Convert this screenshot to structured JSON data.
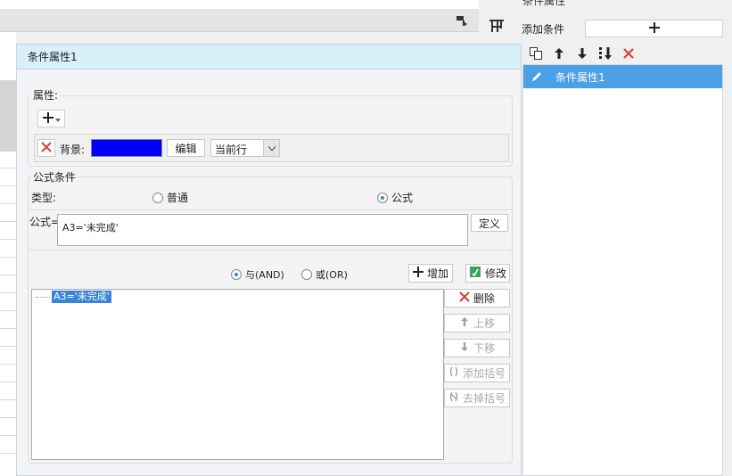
{
  "background": {
    "right_panel_title": "条件属性"
  },
  "right_panel": {
    "add_condition_label": "添加条件",
    "add_button_icon": "plus-icon",
    "toolbar_icons": [
      "copy-icon",
      "arrow-up-icon",
      "arrow-down-icon",
      "move-bottom-icon",
      "delete-icon"
    ],
    "items": [
      {
        "label": "条件属性1",
        "icon": "pencil-icon",
        "selected": true
      }
    ]
  },
  "dialog": {
    "title": "条件属性1",
    "attributes": {
      "section_label": "属性:",
      "background_label": "背景:",
      "background_color": "#0000ff",
      "edit_button": "编辑",
      "scope_select": "当前行"
    },
    "formula_condition": {
      "section_label": "公式条件",
      "type_label": "类型:",
      "type_options": [
        {
          "label": "普通",
          "checked": false
        },
        {
          "label": "公式",
          "checked": true
        }
      ],
      "formula_label": "公式=",
      "formula_value": "A3='未完成'",
      "define_button": "定义",
      "logic_options": [
        {
          "label": "与(AND)",
          "checked": true
        },
        {
          "label": "或(OR)",
          "checked": false
        }
      ],
      "add_button": "增加",
      "modify_button": "修改",
      "conditions": [
        "A3='未完成'"
      ],
      "side_buttons": [
        {
          "label": "删除",
          "enabled": true
        },
        {
          "label": "上移",
          "enabled": false
        },
        {
          "label": "下移",
          "enabled": false
        },
        {
          "label": "添加括号",
          "enabled": false
        },
        {
          "label": "去掉括号",
          "enabled": false
        }
      ]
    }
  }
}
